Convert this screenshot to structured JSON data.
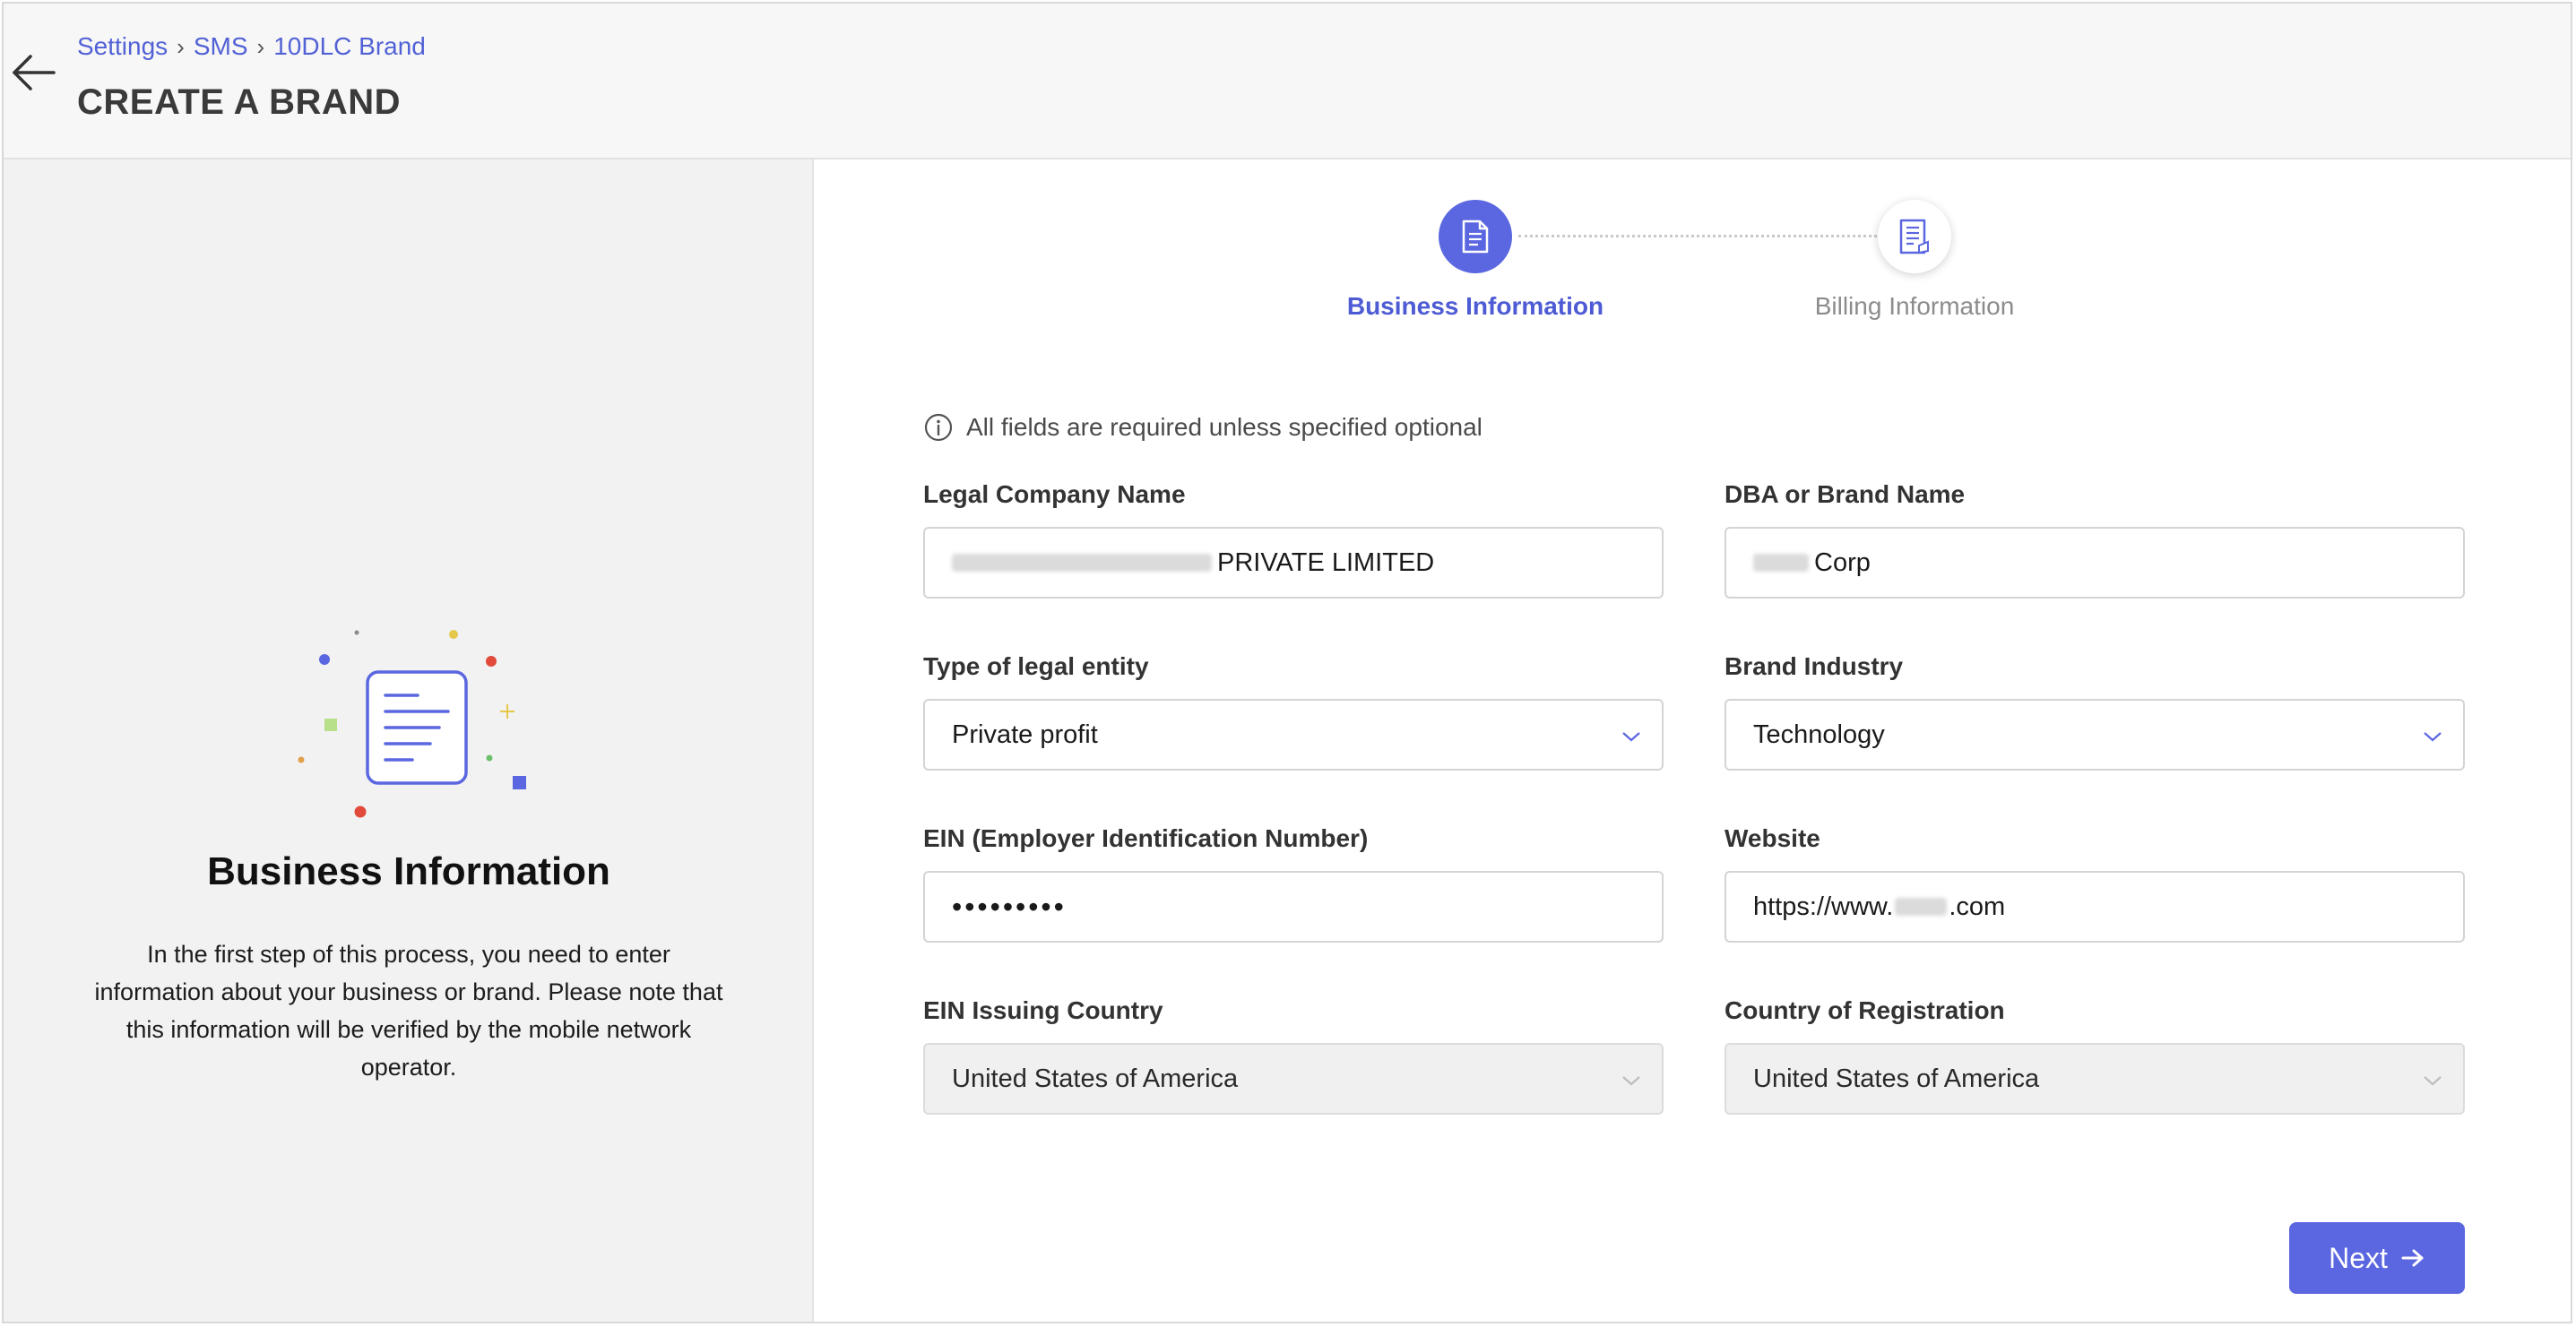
{
  "header": {
    "breadcrumb": [
      "Settings",
      "SMS",
      "10DLC Brand"
    ],
    "breadcrumb_sep": "›",
    "title": "CREATE A BRAND"
  },
  "left_panel": {
    "title": "Business Information",
    "description": "In the first step of this process, you need to enter information about your business or brand. Please note that this information will be verified by the mobile network operator."
  },
  "stepper": {
    "steps": [
      {
        "label": "Business Information",
        "active": true,
        "icon": "document-icon"
      },
      {
        "label": "Billing Information",
        "active": false,
        "icon": "invoice-icon"
      }
    ]
  },
  "form": {
    "info_text": "All fields are required unless specified optional",
    "legal_company_name": {
      "label": "Legal Company Name",
      "value": "PRIVATE LIMITED"
    },
    "dba_brand_name": {
      "label": "DBA or Brand Name",
      "value": "Corp"
    },
    "legal_entity_type": {
      "label": "Type of legal entity",
      "value": "Private profit"
    },
    "brand_industry": {
      "label": "Brand Industry",
      "value": "Technology"
    },
    "ein": {
      "label": "EIN (Employer Identification Number)",
      "value": "•••••••••"
    },
    "website": {
      "label": "Website",
      "value_prefix": "https://www.",
      "value_suffix": ".com"
    },
    "ein_country": {
      "label": "EIN Issuing Country",
      "value": "United States of America"
    },
    "registration_country": {
      "label": "Country of Registration",
      "value": "United States of America"
    }
  },
  "actions": {
    "next_label": "Next"
  },
  "colors": {
    "accent": "#5b67e0",
    "link": "#5262d6"
  }
}
